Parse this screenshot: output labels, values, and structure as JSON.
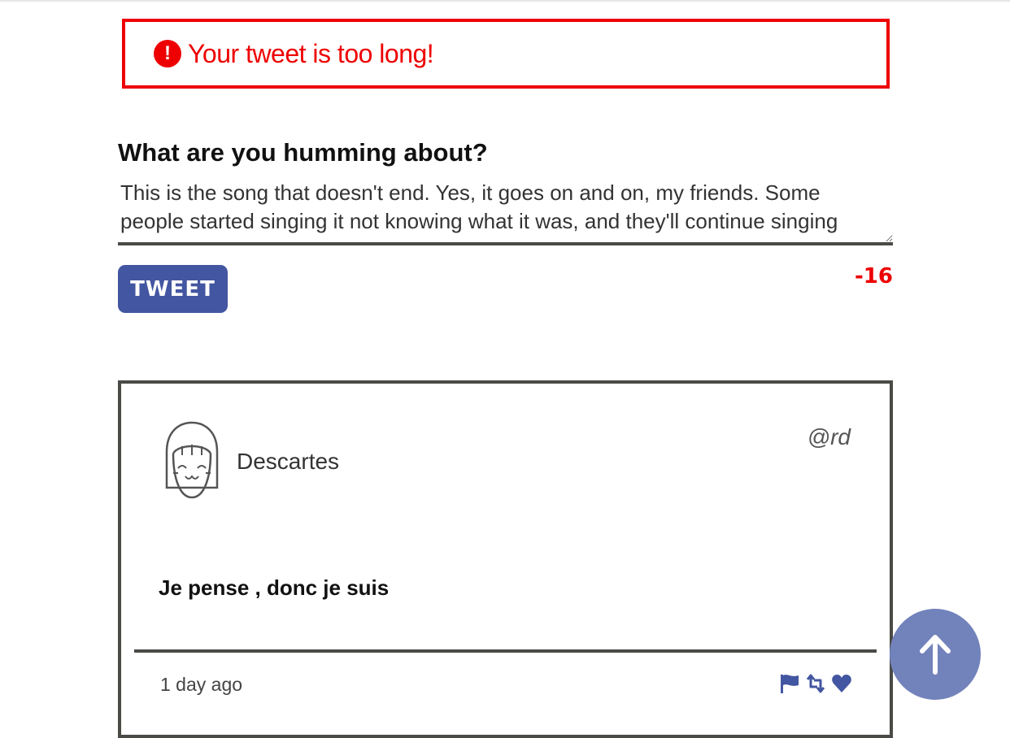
{
  "error": {
    "message": "Your tweet is too long!",
    "icon": "exclamation-circle-icon",
    "color": "#ee0000"
  },
  "compose": {
    "heading": "What are you humming about?",
    "text": "This is the song that doesn't end. Yes, it goes on and on, my friends. Some people started singing it not knowing what it was, and they'll continue singing",
    "button_label": "TWEET",
    "counter": "-16"
  },
  "tweet": {
    "author_name": "Descartes",
    "handle": "@rd",
    "avatar_icon": "smiling-face-avatar-icon",
    "content": "Je pense , donc je suis",
    "time": "1 day ago",
    "actions": [
      "flag-icon",
      "retweet-icon",
      "heart-icon"
    ]
  },
  "scroll_top": {
    "icon": "arrow-up-icon"
  },
  "colors": {
    "accent": "#4356a1",
    "accent_light": "#7282bb",
    "error": "#ee0000",
    "border": "#4a4a46"
  }
}
